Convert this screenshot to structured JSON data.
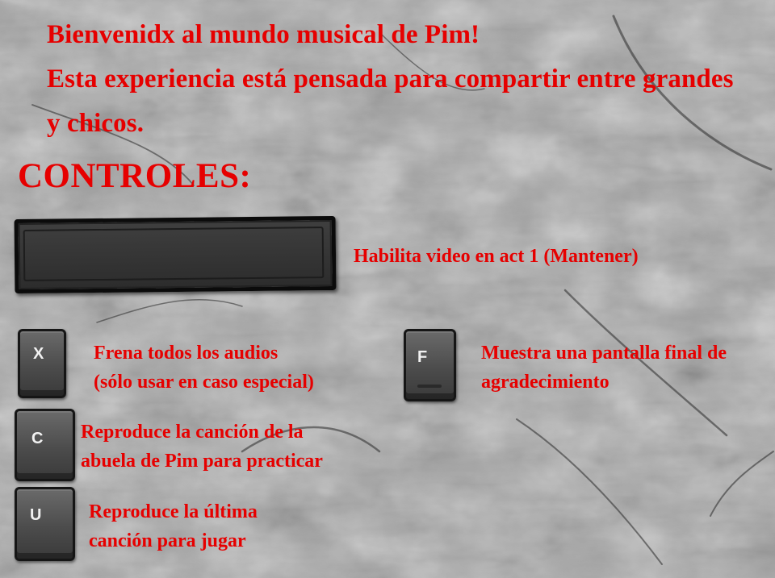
{
  "welcome": {
    "lines": [
      "Bienvenidx al mundo musical de Pim!",
      "Esta experiencia está pensada para compartir entre grandes",
      "y chicos."
    ]
  },
  "controls": {
    "heading": "CONTROLES:",
    "items": [
      {
        "key": "",
        "key_name": "space-key",
        "description": [
          "Habilita video en act 1 (Mantener)"
        ]
      },
      {
        "key": "X",
        "key_name": "x-key",
        "description": [
          "Frena todos los audios",
          "(sólo usar en caso especial)"
        ]
      },
      {
        "key": "F",
        "key_name": "f-key",
        "description": [
          "Muestra una pantalla final de",
          "agradecimiento"
        ]
      },
      {
        "key": "C",
        "key_name": "c-key",
        "description": [
          "Reproduce la canción de la",
          "abuela de Pim para practicar"
        ]
      },
      {
        "key": "U",
        "key_name": "u-key",
        "description": [
          "Reproduce la última",
          "canción para jugar"
        ]
      }
    ]
  },
  "colors": {
    "text_red": "#e60000",
    "background_gray": "#a9a9a9",
    "key_gray": "#4c4c4c"
  }
}
